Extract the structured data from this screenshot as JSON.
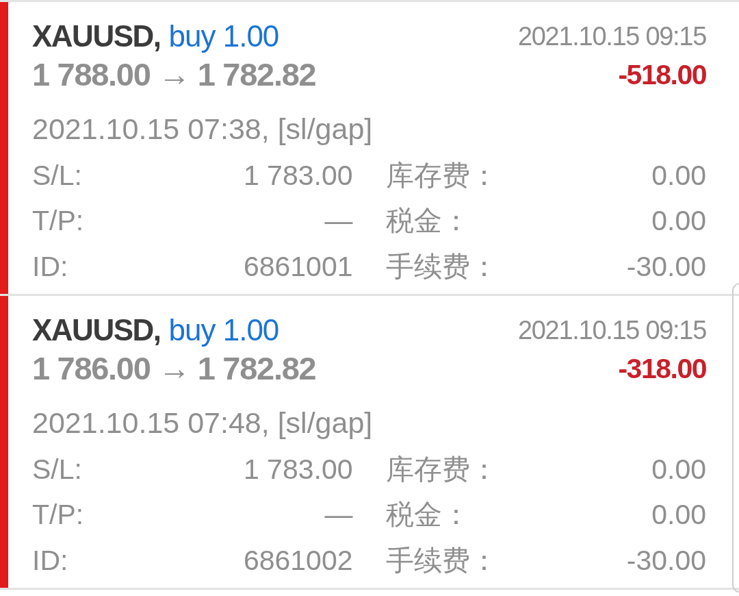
{
  "trades": [
    {
      "symbol": "XAUUSD,",
      "order": "buy 1.00",
      "close_time": "2021.10.15 09:15",
      "prices": "1 788.00 → 1 782.82",
      "profit": "-518.00",
      "open_info": "2021.10.15 07:38, [sl/gap]",
      "details": [
        {
          "label": "S/L:",
          "value": "1 783.00"
        },
        {
          "label": "库存费：",
          "value": "0.00"
        },
        {
          "label": "T/P:",
          "value": "—"
        },
        {
          "label": "税金：",
          "value": "0.00"
        },
        {
          "label": "ID:",
          "value": "6861001"
        },
        {
          "label": "手续费：",
          "value": "-30.00"
        }
      ]
    },
    {
      "symbol": "XAUUSD,",
      "order": "buy 1.00",
      "close_time": "2021.10.15 09:15",
      "prices": "1 786.00 → 1 782.82",
      "profit": "-318.00",
      "open_info": "2021.10.15 07:48, [sl/gap]",
      "details": [
        {
          "label": "S/L:",
          "value": "1 783.00"
        },
        {
          "label": "库存费：",
          "value": "0.00"
        },
        {
          "label": "T/P:",
          "value": "—"
        },
        {
          "label": "税金：",
          "value": "0.00"
        },
        {
          "label": "ID:",
          "value": "6861002"
        },
        {
          "label": "手续费：",
          "value": "-30.00"
        }
      ]
    }
  ]
}
